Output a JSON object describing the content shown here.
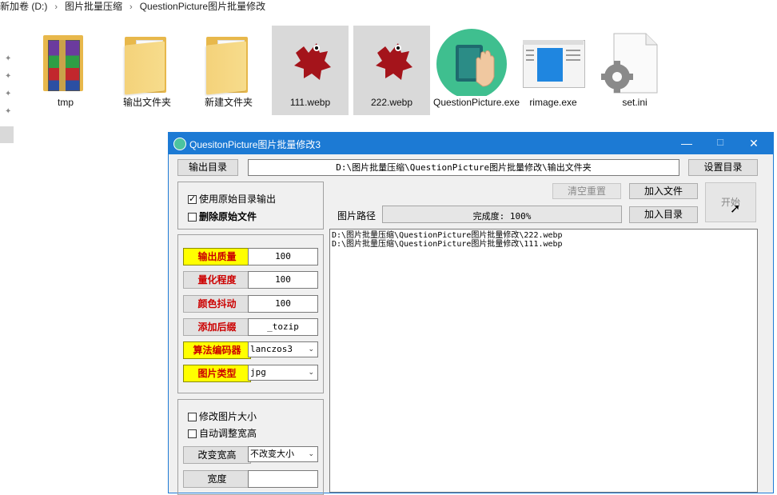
{
  "breadcrumb": [
    "新加卷 (D:)",
    "图片批量压缩",
    "QuestionPicture图片批量修改"
  ],
  "files": [
    {
      "name": "tmp",
      "icon": "winrar-archive-icon"
    },
    {
      "name": "输出文件夹",
      "icon": "folder-icon"
    },
    {
      "name": "新建文件夹",
      "icon": "folder-icon"
    },
    {
      "name": "111.webp",
      "icon": "webp-image-icon"
    },
    {
      "name": "222.webp",
      "icon": "webp-image-icon"
    },
    {
      "name": "QuestionPicture.exe",
      "icon": "book-hand-app-icon"
    },
    {
      "name": "rimage.exe",
      "icon": "rimage-app-icon"
    },
    {
      "name": "set.ini",
      "icon": "settings-file-icon"
    }
  ],
  "dialog": {
    "title": "QuesitonPicture图片批量修改3",
    "minimize": "—",
    "maximize": "☐",
    "close": "✕",
    "output_dir_button": "输出目录",
    "output_dir_value": "D:\\图片批量压缩\\QuestionPicture图片批量修改\\输出文件夹",
    "set_dir_button": "设置目录",
    "use_original_dir": {
      "label": "使用原始目录输出",
      "checked": true
    },
    "delete_original": {
      "label": "删除原始文件",
      "checked": false
    },
    "clear_reset_button": "清空重置",
    "add_file_button": "加入文件",
    "add_dir_button": "加入目录",
    "start_button": "开始",
    "path_label": "图片路径",
    "progress": {
      "text": "完成度: 100%",
      "percent": 100
    },
    "file_list": [
      "D:\\图片批量压缩\\QuestionPicture图片批量修改\\222.webp",
      "D:\\图片批量压缩\\QuestionPicture图片批量修改\\111.webp"
    ],
    "params": [
      {
        "label": "输出质量",
        "value": "100",
        "highlight": true,
        "kind": "field"
      },
      {
        "label": "量化程度",
        "value": "100",
        "highlight": false,
        "kind": "field"
      },
      {
        "label": "颜色抖动",
        "value": "100",
        "highlight": false,
        "kind": "field"
      },
      {
        "label": "添加后缀",
        "value": "_tozip",
        "highlight": false,
        "kind": "field"
      },
      {
        "label": "算法编码器",
        "value": "lanczos3",
        "highlight": true,
        "kind": "combo"
      },
      {
        "label": "图片类型",
        "value": "jpg",
        "highlight": true,
        "kind": "combo"
      }
    ],
    "resize_image": {
      "label": "修改图片大小",
      "checked": false
    },
    "auto_adjust": {
      "label": "自动调整宽高",
      "checked": false
    },
    "change_size_button": "改变宽高",
    "change_size_value": "不改变大小",
    "width_button": "宽度",
    "width_value": ""
  },
  "colors": {
    "titlebar": "#1c7ad4",
    "highlight": "#ffff00",
    "label_red": "#cc0000"
  }
}
